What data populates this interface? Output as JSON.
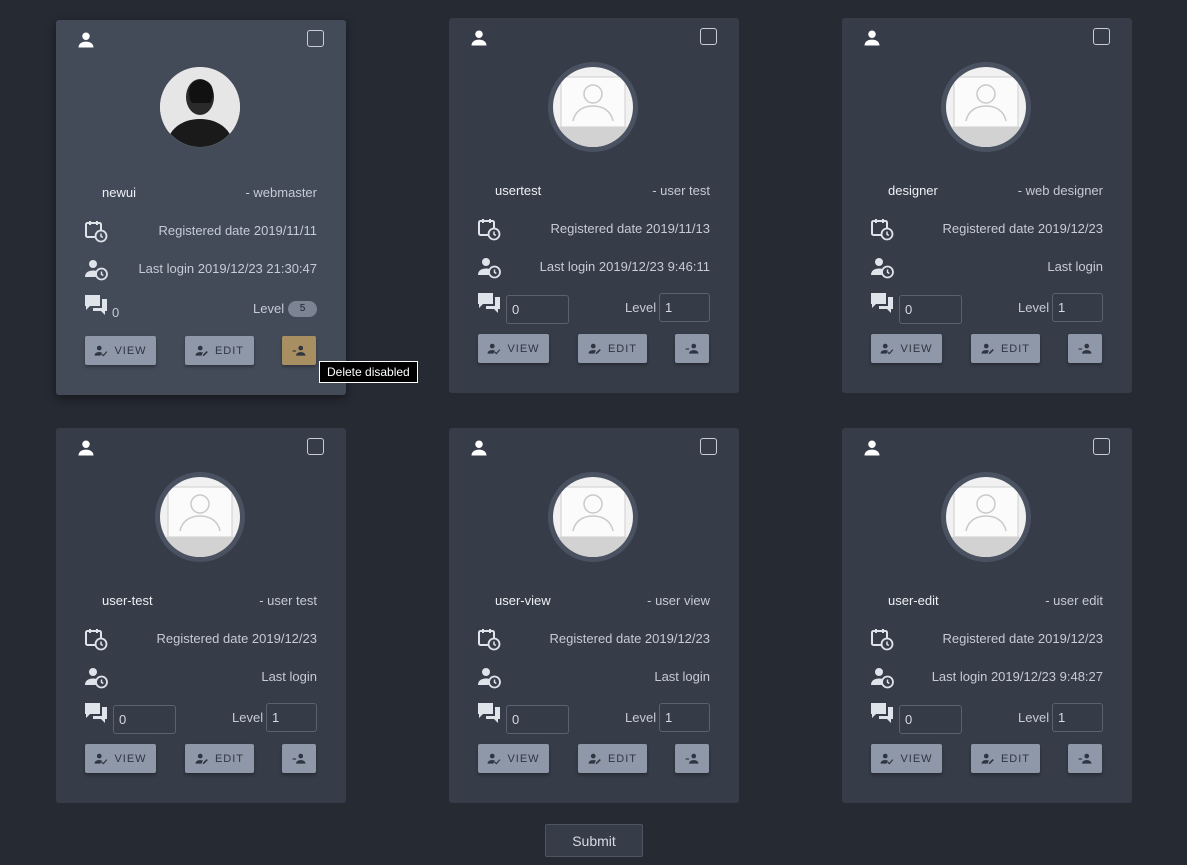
{
  "tooltip": "Delete disabled",
  "submit_label": "Submit",
  "buttons": {
    "view": "VIEW",
    "edit": "EDIT"
  },
  "cards": [
    {
      "name": "newui",
      "role": "- webmaster",
      "registered": "Registered date 2019/11/11",
      "last_login": "Last login 2019/12/23 21:30:47",
      "messages": "0",
      "level_label": "Level",
      "level": "5"
    },
    {
      "name": "usertest",
      "role": "- user test",
      "registered": "Registered date 2019/11/13",
      "last_login": "Last login 2019/12/23 9:46:11",
      "messages": "0",
      "level_label": "Level",
      "level": "1"
    },
    {
      "name": "designer",
      "role": "- web designer",
      "registered": "Registered date 2019/12/23",
      "last_login": "Last login",
      "messages": "0",
      "level_label": "Level",
      "level": "1"
    },
    {
      "name": "user-test",
      "role": "- user test",
      "registered": "Registered date 2019/12/23",
      "last_login": "Last login",
      "messages": "0",
      "level_label": "Level",
      "level": "1"
    },
    {
      "name": "user-view",
      "role": "- user view",
      "registered": "Registered date 2019/12/23",
      "last_login": "Last login",
      "messages": "0",
      "level_label": "Level",
      "level": "1"
    },
    {
      "name": "user-edit",
      "role": "- user edit",
      "registered": "Registered date 2019/12/23",
      "last_login": "Last login 2019/12/23 9:48:27",
      "messages": "0",
      "level_label": "Level",
      "level": "1"
    }
  ],
  "colors": {
    "background": "#262a33",
    "card": "#363c48",
    "card_active": "#434b59",
    "button": "#8f98a8",
    "button_disabled": "#a88f62"
  }
}
